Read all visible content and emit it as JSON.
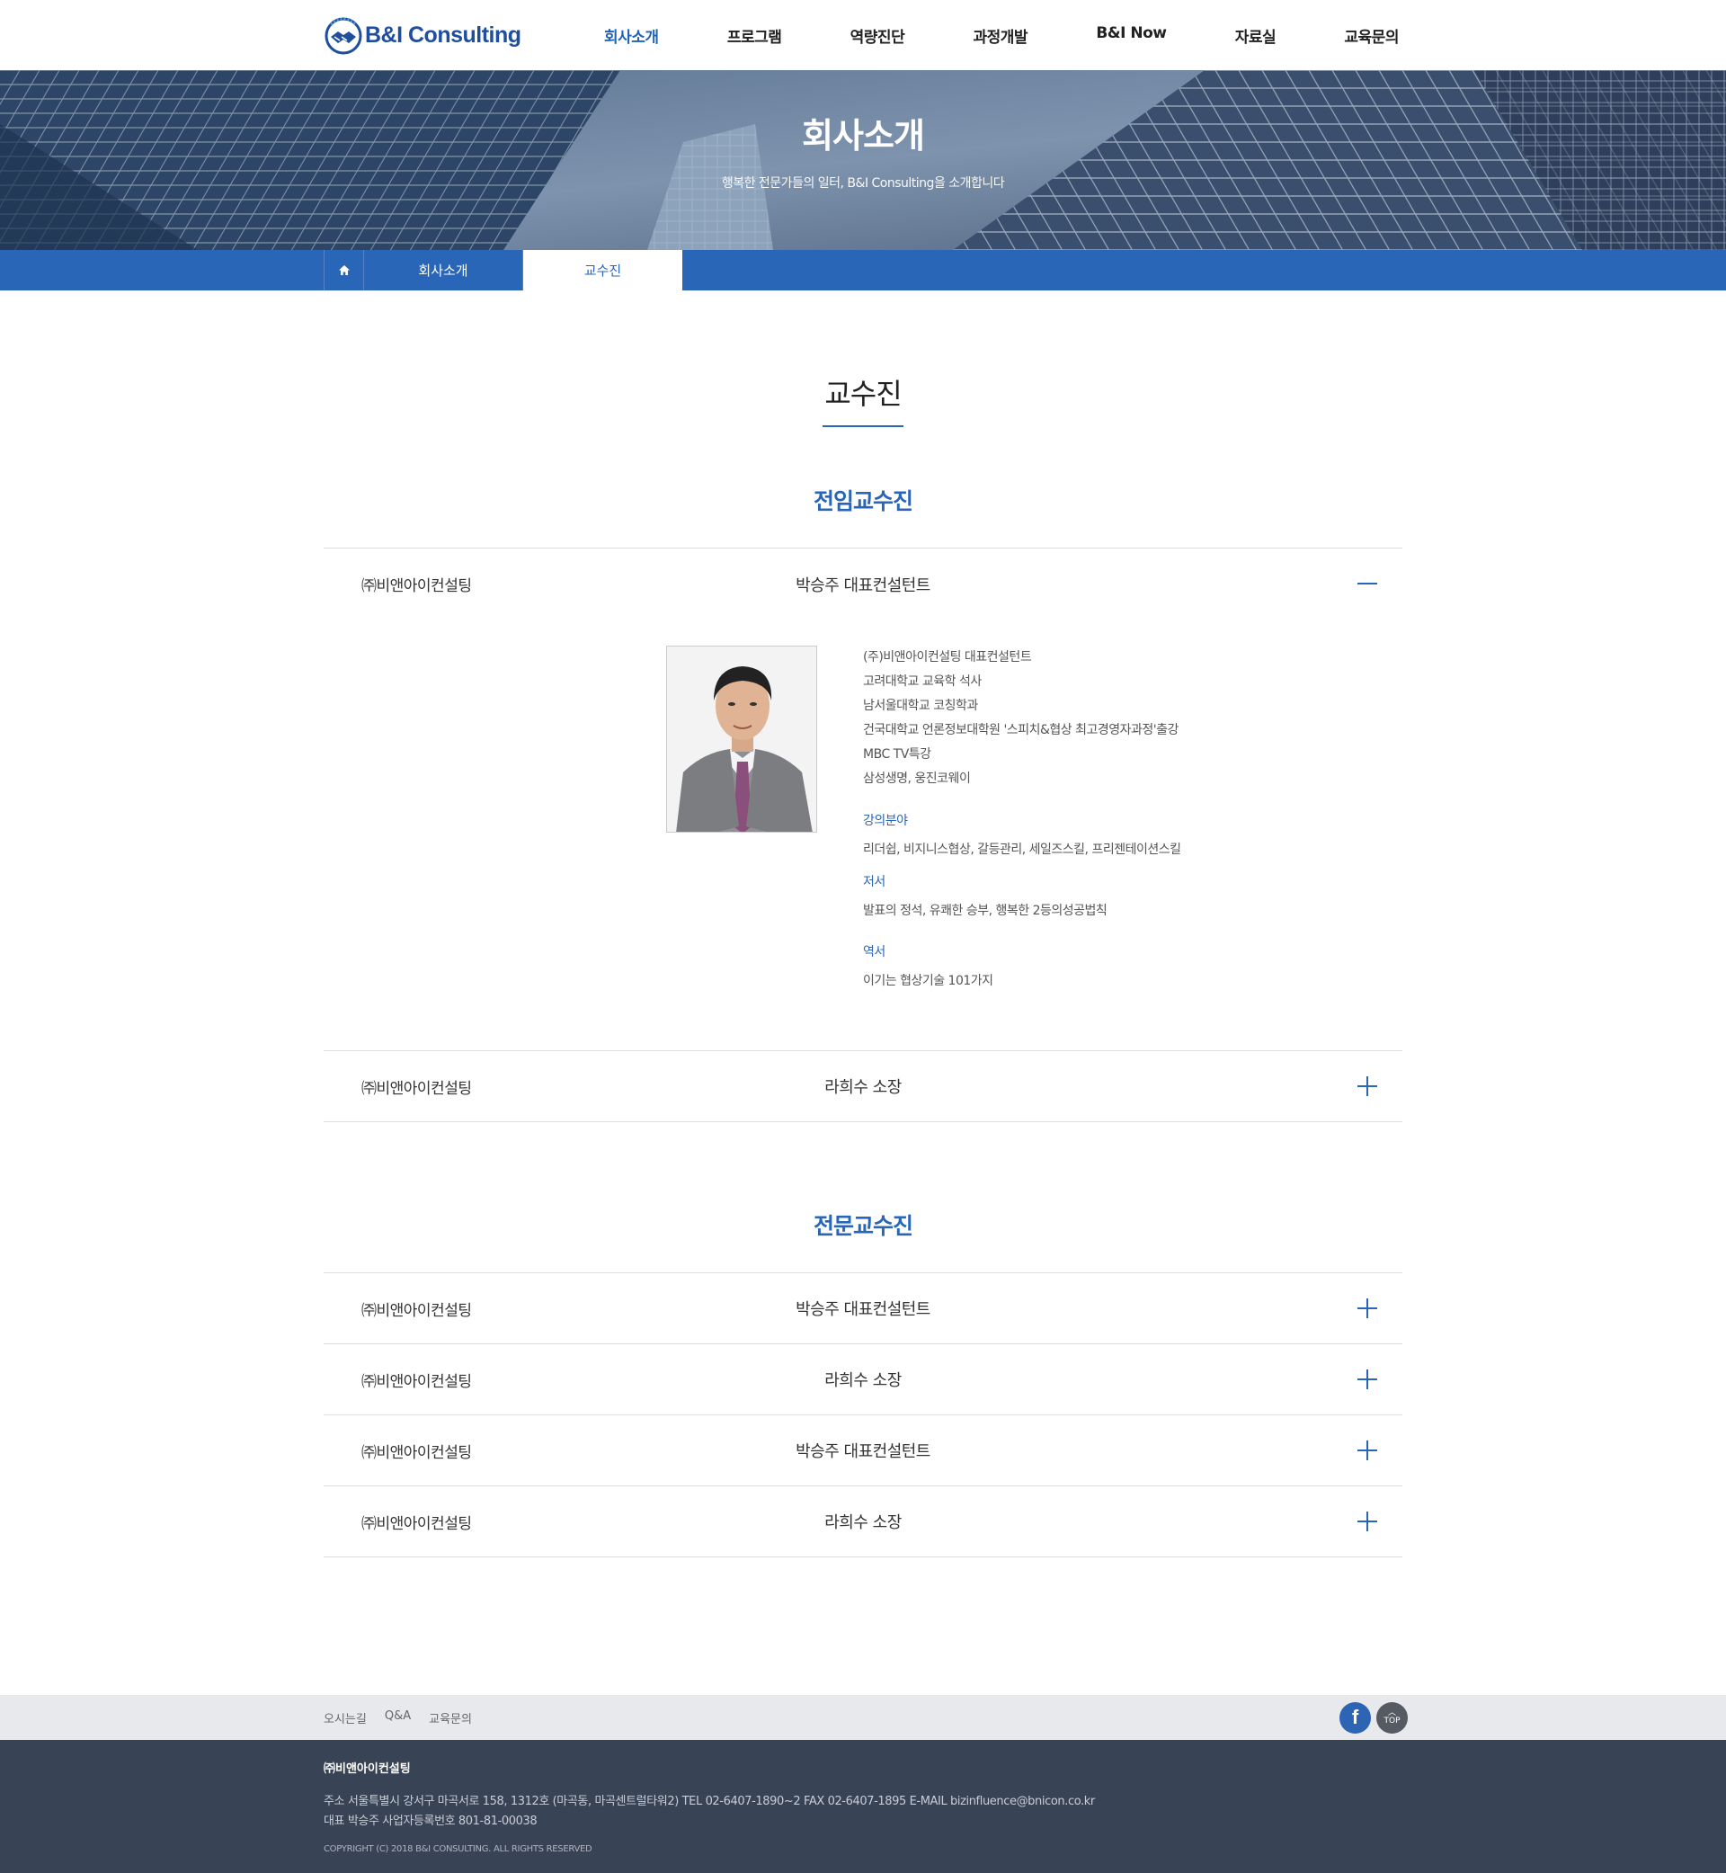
{
  "header": {
    "logo_text": "B&I Consulting",
    "nav": [
      "회사소개",
      "프로그램",
      "역량진단",
      "과정개발",
      "B&I Now",
      "자료실",
      "교육문의"
    ],
    "active_nav": "회사소개"
  },
  "visual": {
    "title": "회사소개",
    "subtitle": "행복한 전문가들의 일터, B&I Consulting을 소개합니다"
  },
  "subnav": {
    "home_icon": "home-icon",
    "items": [
      "회사소개",
      "교수진"
    ],
    "current": "교수진"
  },
  "page": {
    "title": "교수진",
    "sections": [
      {
        "title": "전임교수진",
        "rows": [
          {
            "company": "㈜비앤아이컨설팅",
            "person": "박승주 대표컨설턴트",
            "open": true,
            "detail": {
              "career": [
                "(주)비앤아이컨설팅 대표컨설턴트",
                "고려대학교 교육학 석사",
                "남서울대학교 코칭학과",
                "건국대학교 언론정보대학원 '스피치&협상 최고경영자과정'출강",
                "MBC TV특강",
                "삼성생명, 웅진코웨이"
              ],
              "field_label": "강의분야",
              "field": "리더쉽, 비지니스협상, 갈등관리, 세일즈스킬, 프리젠테이션스킬",
              "books_label": "저서",
              "books": "발표의 정석, 유쾌한 승부, 행복한 2등의성공법칙",
              "translation_label": "역서",
              "translation": "이기는 협상기술 101가지"
            }
          },
          {
            "company": "㈜비앤아이컨설팅",
            "person": "라희수 소장",
            "open": false
          }
        ]
      },
      {
        "title": "전문교수진",
        "rows": [
          {
            "company": "㈜비앤아이컨설팅",
            "person": "박승주 대표컨설턴트",
            "open": false
          },
          {
            "company": "㈜비앤아이컨설팅",
            "person": "라희수 소장",
            "open": false
          },
          {
            "company": "㈜비앤아이컨설팅",
            "person": "박승주 대표컨설턴트",
            "open": false
          },
          {
            "company": "㈜비앤아이컨설팅",
            "person": "라희수 소장",
            "open": false
          }
        ]
      }
    ]
  },
  "footer": {
    "links": [
      "오시는길",
      "Q&A",
      "교육문의"
    ],
    "facebook_icon": "facebook-icon",
    "top_label": "TOP",
    "company": "㈜비앤아이컨설팅",
    "address_line": "주소 서울특별시 강서구 마곡서로 158, 1312호 (마곡동, 마곡센트럴타워2)  TEL 02-6407-1890~2  FAX 02-6407-1895  E-MAIL bizinfluence@bnicon.co.kr",
    "ceo_line": "대표 박승주  사업자등록번호 801-81-00038",
    "copyright": "COPYRIGHT (C) 2018 B&I CONSULTING. ALL RIGHTS RESERVED"
  },
  "colors": {
    "accent": "#2a66b8",
    "brand": "#1e4e9d",
    "footer_bg": "#394356",
    "footer_top_bg": "#e8e9ec"
  }
}
